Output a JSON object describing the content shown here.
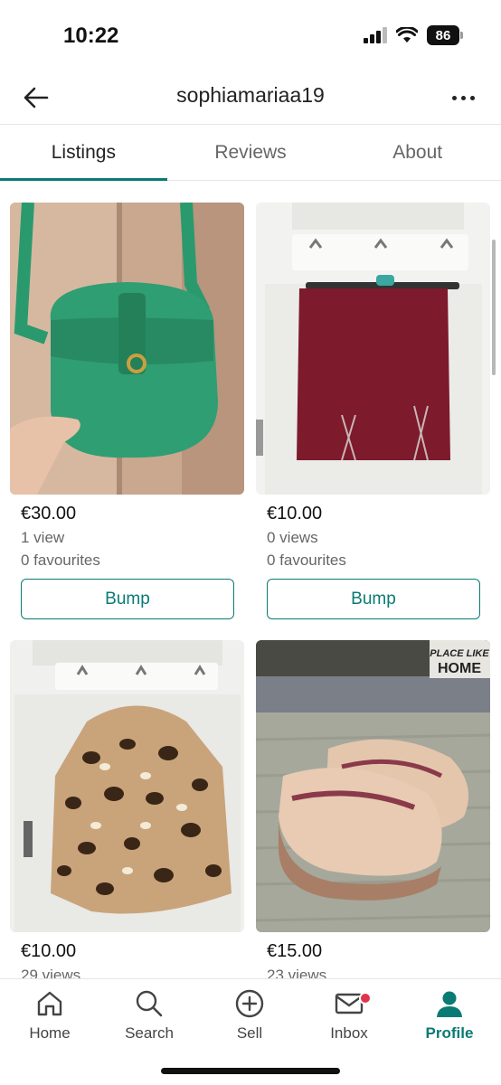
{
  "status_bar": {
    "time": "10:22",
    "battery": "86"
  },
  "header": {
    "username": "sophiamariaa19"
  },
  "tabs": [
    {
      "label": "Listings",
      "active": true
    },
    {
      "label": "Reviews",
      "active": false
    },
    {
      "label": "About",
      "active": false
    }
  ],
  "listings": [
    {
      "price": "€30.00",
      "views": "1 view",
      "favourites": "0 favourites",
      "bump_label": "Bump"
    },
    {
      "price": "€10.00",
      "views": "0 views",
      "favourites": "0 favourites",
      "bump_label": "Bump"
    },
    {
      "price": "€10.00",
      "views": "29 views"
    },
    {
      "price": "€15.00",
      "views": "23 views"
    }
  ],
  "photo_text": {
    "sign": "PLACE LIKE HOME"
  },
  "bottom_nav": [
    {
      "label": "Home",
      "icon": "home-icon"
    },
    {
      "label": "Search",
      "icon": "search-icon"
    },
    {
      "label": "Sell",
      "icon": "plus-circle-icon"
    },
    {
      "label": "Inbox",
      "icon": "envelope-icon",
      "has_badge": true
    },
    {
      "label": "Profile",
      "icon": "person-icon",
      "active": true
    }
  ],
  "colors": {
    "accent": "#0a7a75",
    "badge": "#e0344b"
  }
}
